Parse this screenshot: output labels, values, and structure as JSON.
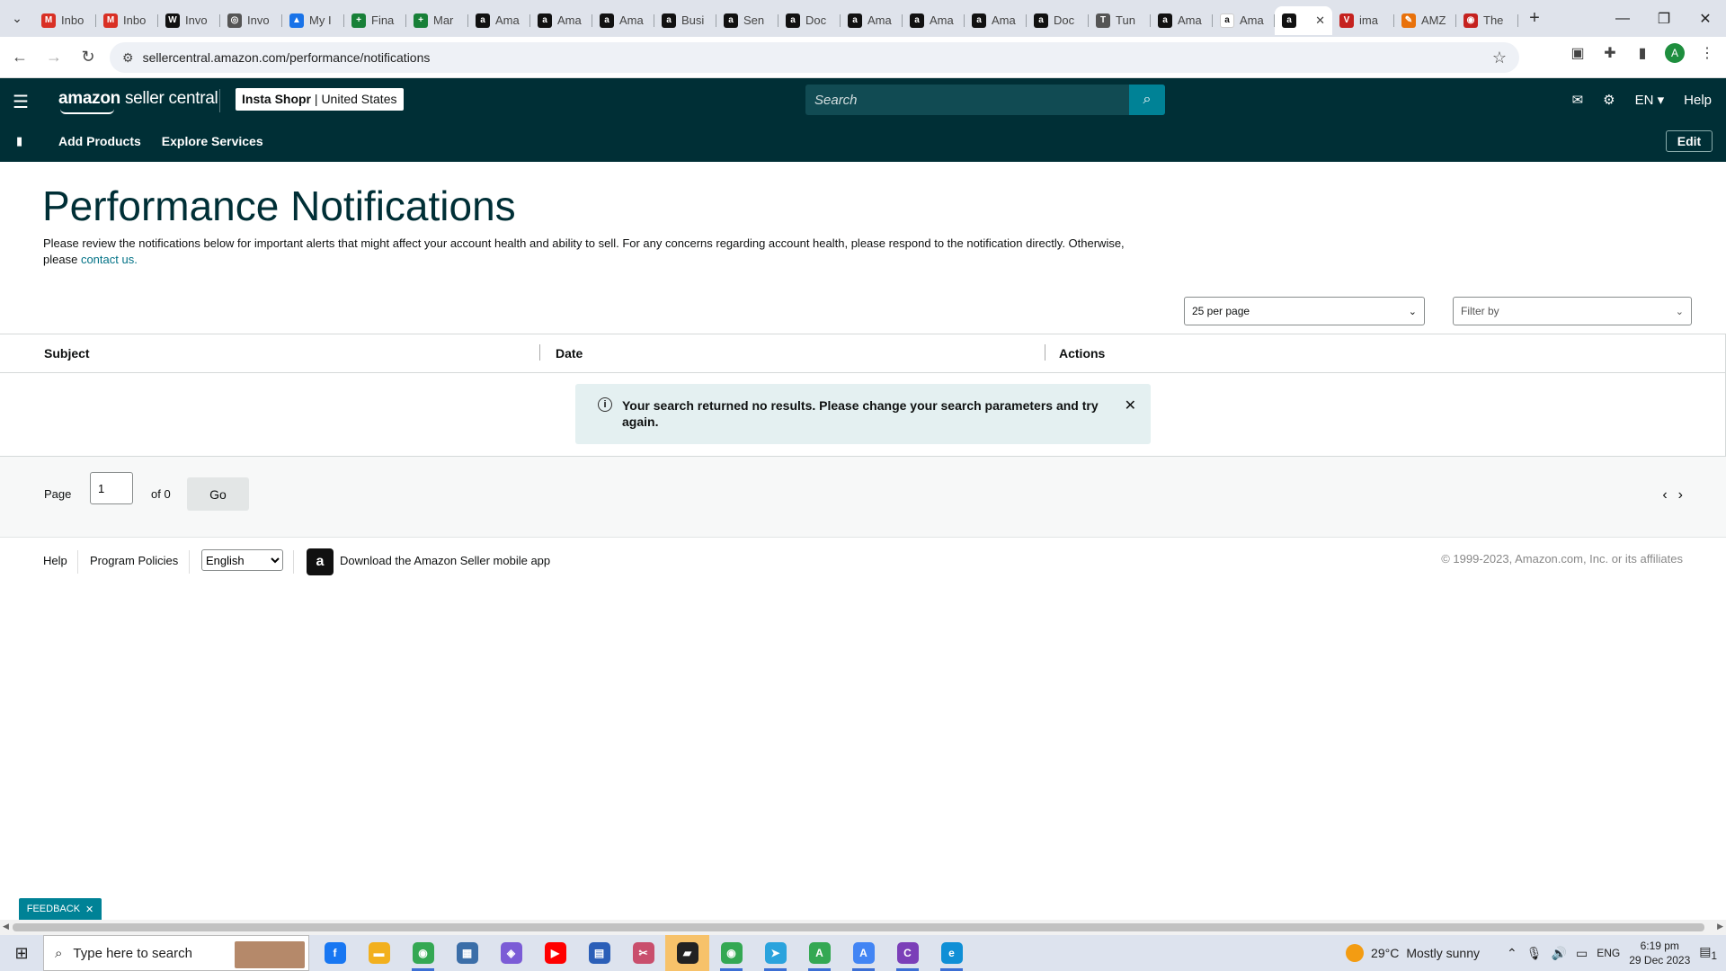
{
  "browser": {
    "tabs": [
      {
        "label": "Inbo",
        "icon": "gmail-icon",
        "color": "#d93025",
        "glyph": "M"
      },
      {
        "label": "Inbo",
        "icon": "gmail-icon",
        "color": "#d93025",
        "glyph": "M"
      },
      {
        "label": "Invo",
        "icon": "wix-icon",
        "color": "#111111",
        "glyph": "W"
      },
      {
        "label": "Invo",
        "icon": "globe-icon",
        "color": "#555555",
        "glyph": "◎"
      },
      {
        "label": "My I",
        "icon": "drive-icon",
        "color": "#1a73e8",
        "glyph": "▲"
      },
      {
        "label": "Fina",
        "icon": "sheets-icon",
        "color": "#188038",
        "glyph": "+"
      },
      {
        "label": "Mar",
        "icon": "sheets-icon",
        "color": "#188038",
        "glyph": "+"
      },
      {
        "label": "Ama",
        "icon": "amazon-icon",
        "color": "#111111",
        "glyph": "a"
      },
      {
        "label": "Ama",
        "icon": "amazon-icon",
        "color": "#111111",
        "glyph": "a"
      },
      {
        "label": "Ama",
        "icon": "amazon-icon",
        "color": "#111111",
        "glyph": "a"
      },
      {
        "label": "Busi",
        "icon": "amazon-icon",
        "color": "#111111",
        "glyph": "a"
      },
      {
        "label": "Sen",
        "icon": "amazon-icon",
        "color": "#111111",
        "glyph": "a"
      },
      {
        "label": "Doc",
        "icon": "amazon-icon",
        "color": "#111111",
        "glyph": "a"
      },
      {
        "label": "Ama",
        "icon": "amazon-icon",
        "color": "#111111",
        "glyph": "a"
      },
      {
        "label": "Ama",
        "icon": "amazon-icon",
        "color": "#111111",
        "glyph": "a"
      },
      {
        "label": "Ama",
        "icon": "amazon-icon",
        "color": "#111111",
        "glyph": "a"
      },
      {
        "label": "Doc",
        "icon": "amazon-icon",
        "color": "#111111",
        "glyph": "a"
      },
      {
        "label": "Tun",
        "icon": "tunnel-icon",
        "color": "#555555",
        "glyph": "T"
      },
      {
        "label": "Ama",
        "icon": "amazon-icon",
        "color": "#111111",
        "glyph": "a"
      },
      {
        "label": "Ama",
        "icon": "amazon-smile-icon",
        "color": "#ffffff",
        "glyph": "a"
      },
      {
        "label": "",
        "icon": "amazon-icon",
        "color": "#111111",
        "glyph": "a",
        "active": true
      },
      {
        "label": "ima",
        "icon": "image-icon",
        "color": "#c5221f",
        "glyph": "V"
      },
      {
        "label": "AMZ",
        "icon": "pencil-icon",
        "color": "#e8710a",
        "glyph": "✎"
      },
      {
        "label": "The",
        "icon": "circle-icon",
        "color": "#c5221f",
        "glyph": "◉"
      }
    ],
    "url": "sellercentral.amazon.com/performance/notifications",
    "avatar_letter": "A"
  },
  "topnav": {
    "logo_brand": "amazon",
    "logo_suffix": "seller central",
    "store_name": "Insta Shopr",
    "store_region": "United States",
    "search_placeholder": "Search",
    "language": "EN",
    "help": "Help"
  },
  "subnav": {
    "links": [
      "Add Products",
      "Explore Services"
    ],
    "edit": "Edit"
  },
  "page": {
    "title": "Performance Notifications",
    "description": "Please review the notifications below for important alerts that might affect your account health and ability to sell. For any concerns regarding account health, please respond to the notification directly. Otherwise, please",
    "contact_link": "contact us.",
    "per_page": "25 per page",
    "filter_by": "Filter by"
  },
  "table": {
    "columns": [
      "Subject",
      "Date",
      "Actions"
    ],
    "empty_message": "Your search returned no results. Please change your search parameters and try again."
  },
  "pager": {
    "page_label": "Page",
    "page_value": "1",
    "of_label": "of 0",
    "go": "Go"
  },
  "footer": {
    "help": "Help",
    "program_policies": "Program Policies",
    "language": "English",
    "app_text": "Download the Amazon Seller mobile app",
    "copyright": "© 1999-2023, Amazon.com, Inc. or its affiliates"
  },
  "feedback": "FEEDBACK",
  "taskbar": {
    "search_placeholder": "Type here to search",
    "apps": [
      {
        "icon": "facebook-icon",
        "color": "#1877f2",
        "glyph": "f"
      },
      {
        "icon": "file-explorer-icon",
        "color": "#f2b01e",
        "glyph": "▬"
      },
      {
        "icon": "chrome-icon",
        "color": "#34a853",
        "glyph": "◉",
        "active": true
      },
      {
        "icon": "calculator-icon",
        "color": "#3b6ea8",
        "glyph": "▦"
      },
      {
        "icon": "copilot-icon",
        "color": "#7b5cd6",
        "glyph": "◈"
      },
      {
        "icon": "youtube-icon",
        "color": "#ff0000",
        "glyph": "▶"
      },
      {
        "icon": "store-icon",
        "color": "#2b5fb8",
        "glyph": "▤"
      },
      {
        "icon": "snipping-tool-icon",
        "color": "#c94f6d",
        "glyph": "✂"
      },
      {
        "icon": "sticky-notes-icon",
        "color": "#222222",
        "glyph": "▰",
        "highlight": true
      },
      {
        "icon": "chrome-profile-icon",
        "color": "#34a853",
        "glyph": "◉",
        "active": true
      },
      {
        "icon": "telegram-icon",
        "color": "#2aa3dd",
        "glyph": "➤",
        "active": true
      },
      {
        "icon": "chrome-profile-a-icon",
        "color": "#34a853",
        "glyph": "A",
        "active": true
      },
      {
        "icon": "chrome-profile-a2-icon",
        "color": "#4285f4",
        "glyph": "A",
        "active": true
      },
      {
        "icon": "chrome-profile-c-icon",
        "color": "#7b3fb8",
        "glyph": "C",
        "active": true
      },
      {
        "icon": "edge-icon",
        "color": "#0f8fd6",
        "glyph": "e",
        "active": true
      }
    ],
    "weather_temp": "29°C",
    "weather_desc": "Mostly sunny",
    "lang": "ENG",
    "time": "6:19 pm",
    "date": "29 Dec 2023",
    "notif_count": "1"
  }
}
